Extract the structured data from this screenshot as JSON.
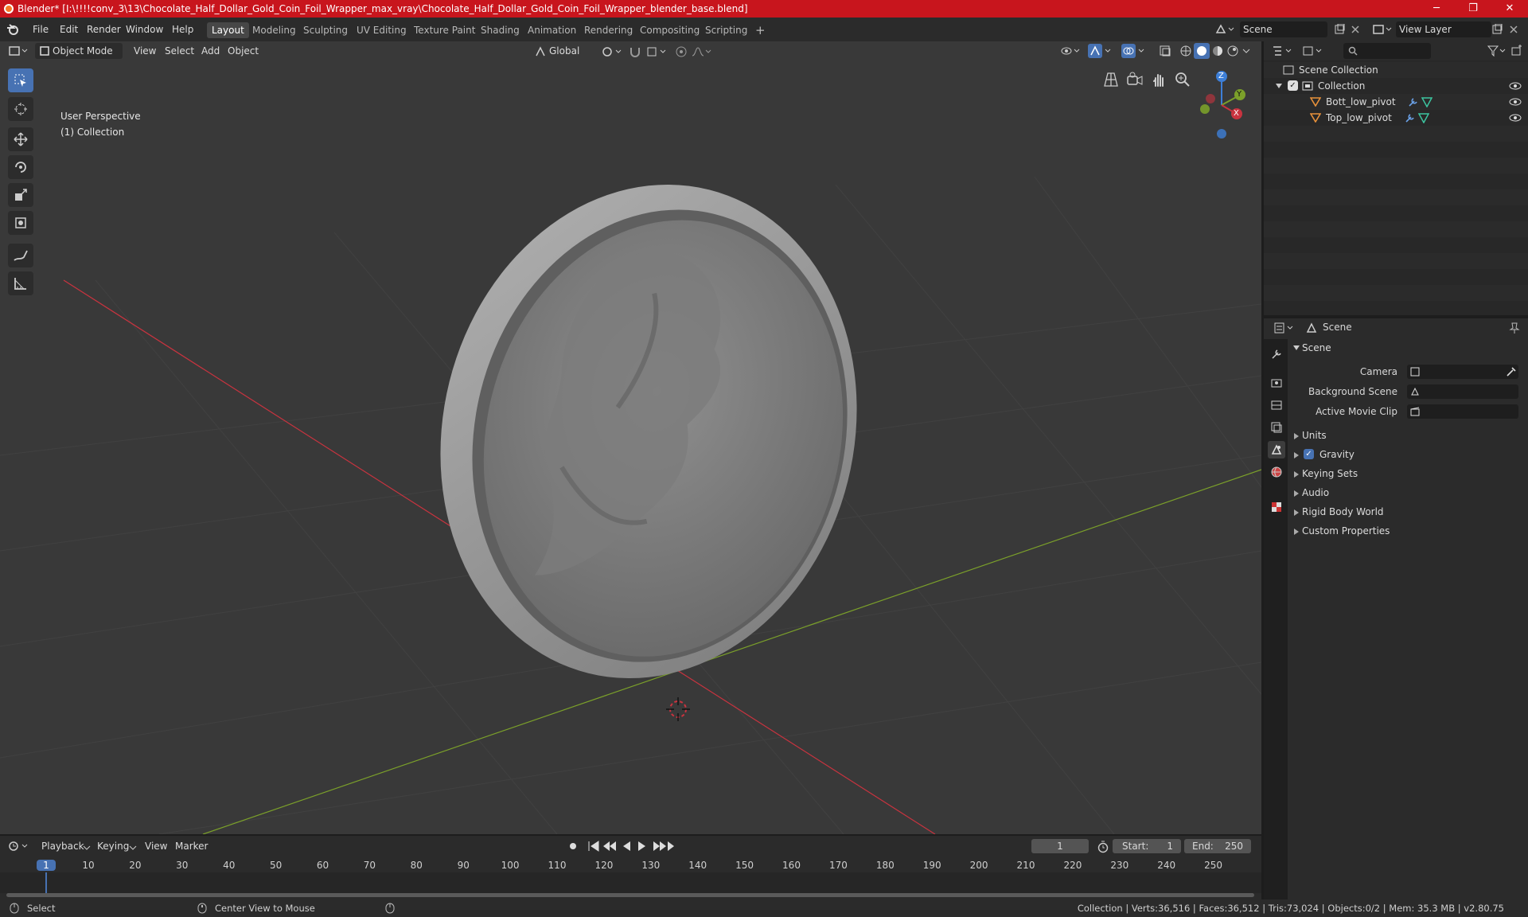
{
  "window": {
    "title": "Blender* [I:\\!!!!conv_3\\13\\Chocolate_Half_Dollar_Gold_Coin_Foil_Wrapper_max_vray\\Chocolate_Half_Dollar_Gold_Coin_Foil_Wrapper_blender_base.blend]",
    "minimize": "─",
    "maximize": "❐",
    "close": "✕"
  },
  "menu": {
    "items": [
      "File",
      "Edit",
      "Render",
      "Window",
      "Help"
    ]
  },
  "workspaces": {
    "tabs": [
      "Layout",
      "Modeling",
      "Sculpting",
      "UV Editing",
      "Texture Paint",
      "Shading",
      "Animation",
      "Rendering",
      "Compositing",
      "Scripting"
    ],
    "active": "Layout",
    "add": "+"
  },
  "scene_selector": {
    "value": "Scene"
  },
  "view_layer_selector": {
    "value": "View Layer"
  },
  "viewport_header": {
    "mode": "Object Mode",
    "menus": [
      "View",
      "Select",
      "Add",
      "Object"
    ],
    "orientation": "Global"
  },
  "viewport": {
    "perspective": "User Perspective",
    "collection": "(1) Collection",
    "gizmo": {
      "z": "Z",
      "y": "Y",
      "x": "X"
    }
  },
  "outliner": {
    "root": "Scene Collection",
    "collection": "Collection",
    "objects": [
      "Bott_low_pivot",
      "Top_low_pivot"
    ]
  },
  "properties": {
    "header": "Scene",
    "panel": "Scene",
    "fields": [
      "Camera",
      "Background Scene",
      "Active Movie Clip"
    ],
    "sections": [
      "Units",
      "Gravity",
      "Keying Sets",
      "Audio",
      "Rigid Body World",
      "Custom Properties"
    ]
  },
  "timeline": {
    "menus": [
      "Playback",
      "Keying",
      "View",
      "Marker"
    ],
    "current_frame": "1",
    "start_label": "Start:",
    "start": "1",
    "end_label": "End:",
    "end": "250",
    "ticks": [
      "1",
      "10",
      "20",
      "30",
      "40",
      "50",
      "60",
      "70",
      "80",
      "90",
      "100",
      "110",
      "120",
      "130",
      "140",
      "150",
      "160",
      "170",
      "180",
      "190",
      "200",
      "210",
      "220",
      "230",
      "240",
      "250"
    ]
  },
  "statusbar": {
    "select": "Select",
    "center": "Center View to Mouse",
    "stats": "Collection | Verts:36,516 | Faces:36,512 | Tris:73,024 | Objects:0/2 | Mem: 35.3 MB | v2.80.75"
  },
  "colors": {
    "accent": "#4772b3",
    "titlebar": "#c8151d",
    "x_axis": "#c9333f",
    "y_axis": "#7ba02a",
    "z_axis": "#3d7fd8"
  }
}
